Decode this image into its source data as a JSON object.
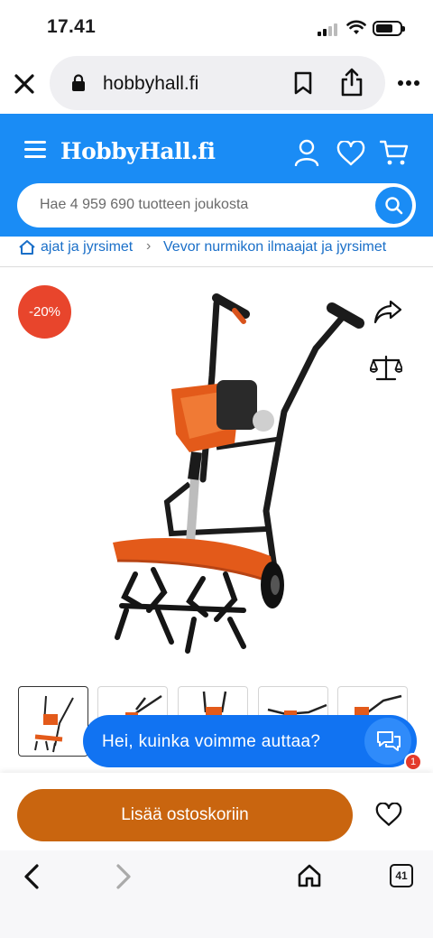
{
  "status_bar": {
    "time": "17.41"
  },
  "browser": {
    "url": "hobbyhall.fi",
    "tab_count": "41"
  },
  "header": {
    "logo": "HobbyHall.fi",
    "search_placeholder": "Hae 4 959 690 tuotteen joukosta"
  },
  "breadcrumb": {
    "items": [
      "ajat ja jyrsimet",
      "Vevor nurmikon ilmaajat ja jyrsimet"
    ]
  },
  "product": {
    "discount": "-20%"
  },
  "chat": {
    "prompt": "Hei, kuinka voimme auttaa?",
    "unread": "1"
  },
  "actions": {
    "add_to_cart": "Lisää ostoskoriin"
  },
  "colors": {
    "brand_blue": "#1a8cf5",
    "cart_button": "#c9650f",
    "discount_badge": "#e8452c",
    "chat_blue": "#1173f2"
  },
  "icons": [
    "close-icon",
    "lock-icon",
    "bookmark-icon",
    "share-icon",
    "more-icon",
    "menu-icon",
    "account-icon",
    "heart-icon",
    "cart-icon",
    "search-icon",
    "home-icon",
    "share-arrow-icon",
    "compare-scale-icon",
    "chat-icon",
    "back-icon",
    "forward-icon",
    "tabs-icon"
  ]
}
